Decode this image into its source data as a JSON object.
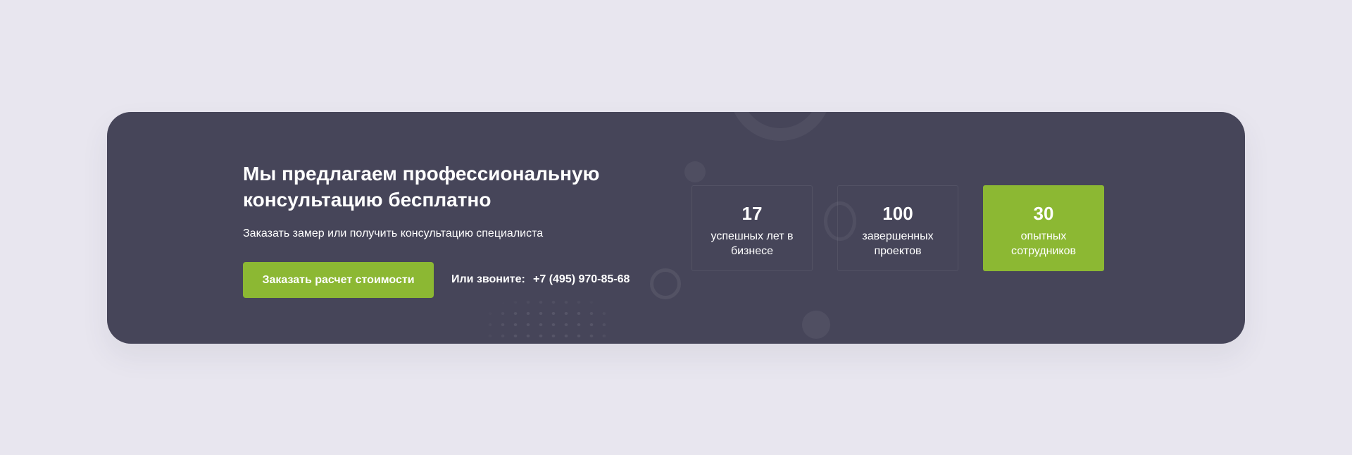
{
  "banner": {
    "title": "Мы предлагаем профессиональную консультацию бесплатно",
    "subtitle": "Заказать замер или получить консультацию специалиста",
    "cta_label": "Заказать расчет стоимости",
    "call_label": "Или звоните:",
    "phone": "+7 (495) 970-85-68"
  },
  "stats": [
    {
      "value": "17",
      "label": "успешных лет в бизнесе"
    },
    {
      "value": "100",
      "label": "завершенных проектов"
    },
    {
      "value": "30",
      "label": "опытных сотрудников"
    }
  ],
  "colors": {
    "page_background": "#e8e6ef",
    "card_background": "#464559",
    "accent": "#8cb833",
    "text": "#ffffff"
  }
}
